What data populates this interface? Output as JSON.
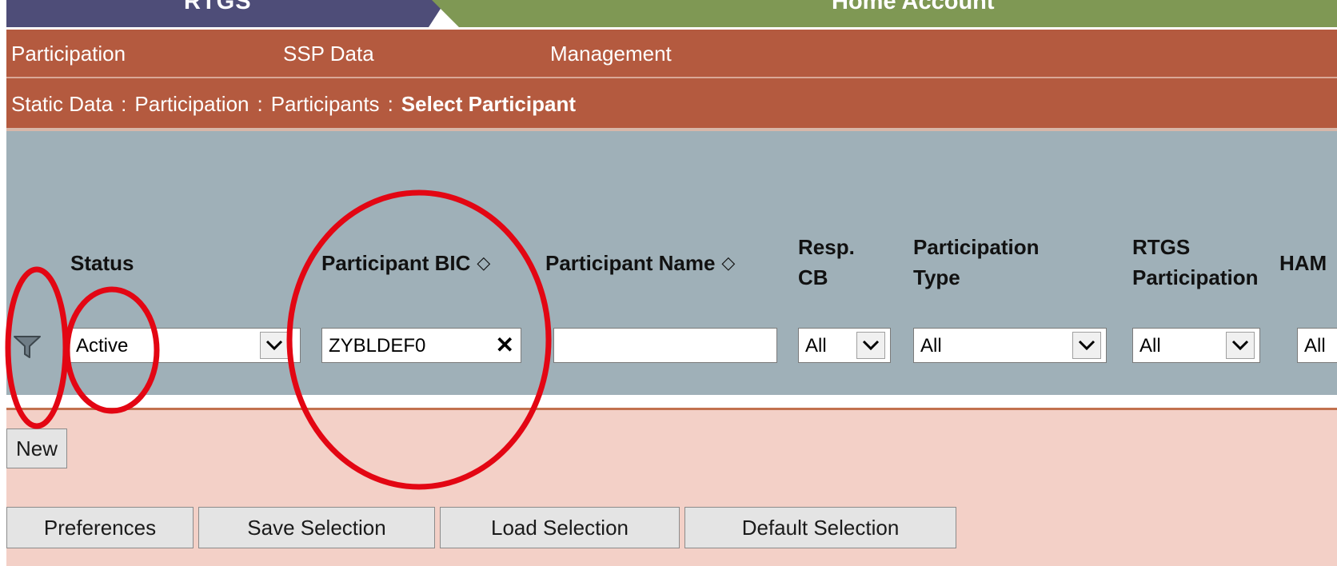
{
  "tabs": {
    "rtgs": "RTGS",
    "home_account": "Home Account"
  },
  "menu": {
    "participation": "Participation",
    "ssp_data": "SSP Data",
    "management": "Management"
  },
  "breadcrumb": {
    "static_data": "Static Data",
    "participation": "Participation",
    "participants": "Participants",
    "current": "Select Participant",
    "separator": ":"
  },
  "columns": {
    "status": "Status",
    "participant_bic": "Participant BIC",
    "participant_name": "Participant Name",
    "resp_cb_line1": "Resp.",
    "resp_cb_line2": "CB",
    "participation_type_line1": "Participation",
    "participation_type_line2": "Type",
    "rtgs_participation_line1": "RTGS",
    "rtgs_participation_line2": "Participation",
    "ham": "HAM"
  },
  "filters": {
    "status_value": "Active",
    "bic_value": "ZYBLDEF0",
    "participant_name_value": "",
    "resp_cb_value": "All",
    "participation_type_value": "All",
    "rtgs_participation_value": "All",
    "ham_value": "All"
  },
  "buttons": {
    "new": "New",
    "preferences": "Preferences",
    "save_selection": "Save Selection",
    "load_selection": "Load Selection",
    "default_selection": "Default Selection"
  },
  "icons": {
    "filter": "funnel-icon",
    "sort": "sort-updown-icon",
    "dropdown": "chevron-down-icon",
    "clear": "close-icon"
  },
  "colors": {
    "tab_rtgs": "#4e4d78",
    "tab_home_account": "#7f9854",
    "nav_bar": "#b45a3f",
    "filter_panel": "#9fb0b8",
    "lower_panel": "#f3d0c7",
    "annotation": "#e30613"
  }
}
